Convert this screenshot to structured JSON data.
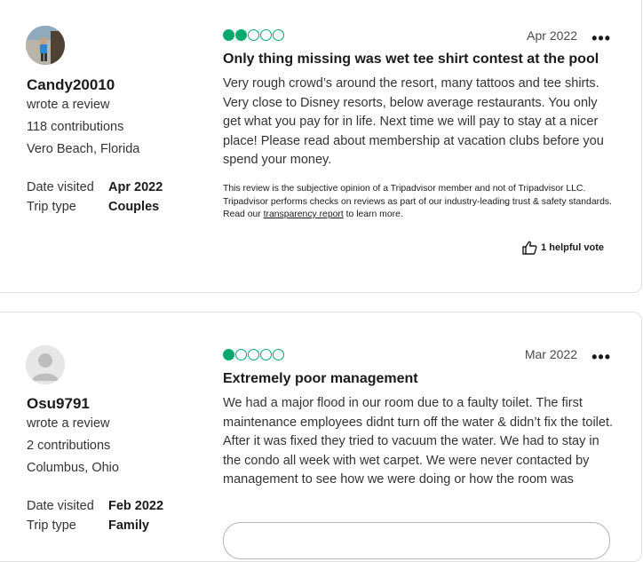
{
  "reviews": [
    {
      "username": "Candy20010",
      "action": "wrote a review",
      "contributions": "118 contributions",
      "location": "Vero Beach, Florida",
      "date_visited_label": "Date visited",
      "date_visited": "Apr 2022",
      "trip_type_label": "Trip type",
      "trip_type": "Couples",
      "rating": 2,
      "rating_max": 5,
      "review_date": "Apr 2022",
      "more_icon": "•••",
      "title": "Only thing missing was wet tee shirt contest at the pool",
      "body": "Very rough crowd’s around the resort, many tattoos and tee shirts.  Very close to Disney resorts, below average restaurants.  You only get what you pay for in life.  Next time we will pay to stay at a nicer place!  Please read about membership at vacation clubs before you spend your money.",
      "disclaimer_prefix": "This review is the subjective opinion of a Tripadvisor member and not of Tripadvisor LLC. Tripadvisor performs checks on reviews as part of our industry-leading trust & safety standards. Read our ",
      "disclaimer_link": "transparency report",
      "disclaimer_suffix": " to learn more.",
      "helpful_votes": "1 helpful vote"
    },
    {
      "username": "Osu9791",
      "action": "wrote a review",
      "contributions": "2 contributions",
      "location": "Columbus, Ohio",
      "date_visited_label": "Date visited",
      "date_visited": "Feb 2022",
      "trip_type_label": "Trip type",
      "trip_type": "Family",
      "rating": 1,
      "rating_max": 5,
      "review_date": "Mar 2022",
      "more_icon": "•••",
      "title": "Extremely poor management",
      "body": "We had a major flood in our room due to a faulty toilet. The first maintenance employees didnt turn off the water & didn’t fix the toilet. After it was fixed they tried to vacuum the water. We had to stay in the condo all week with wet carpet. We were never contacted by management to see how we were doing or how the room was"
    }
  ],
  "colors": {
    "bubble": "#00aa6c",
    "text": "#333333",
    "heading": "#1a1a1a",
    "border": "#e0e0e0"
  },
  "icons": {
    "avatar_default": "user-silhouette-icon",
    "helpful": "thumbs-up-icon",
    "more": "ellipsis-icon"
  }
}
